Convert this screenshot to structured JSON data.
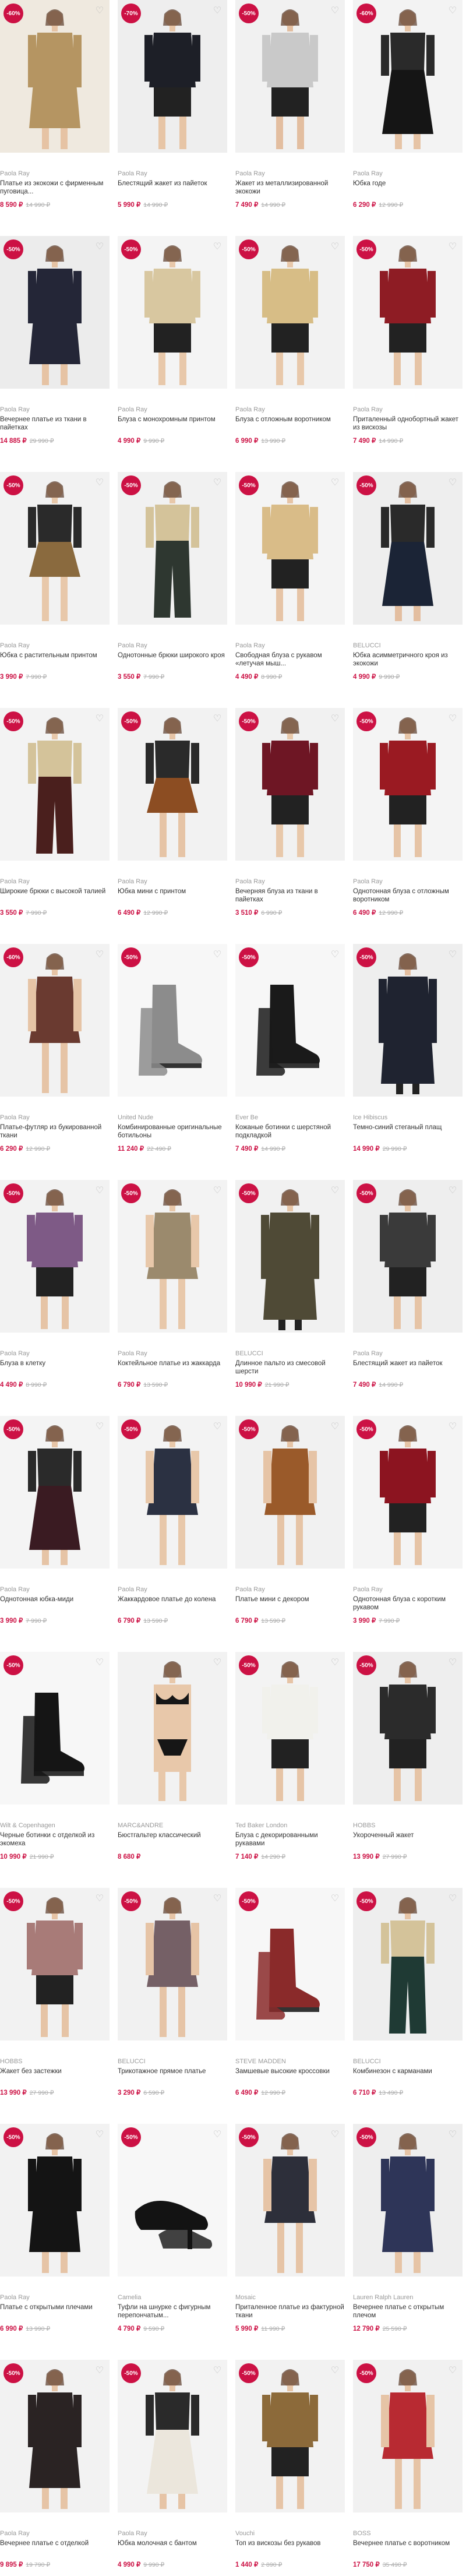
{
  "products": [
    {
      "brand": "Paola Ray",
      "title": "Платье из экокожи с фирменным пуговица...",
      "price": "8 590 ₽",
      "old_price": "14 990 ₽",
      "badge": "-60%",
      "bg": "#efe9df",
      "item": "#b59562",
      "skin": "#e6c3a4",
      "shape": "dress-long"
    },
    {
      "brand": "Paola Ray",
      "title": "Блестящий жакет из пайеток",
      "price": "5 990 ₽",
      "old_price": "14 990 ₽",
      "badge": "-70%",
      "bg": "#eeeeee",
      "item": "#1d1f27",
      "skin": "#e7c5a6",
      "shape": "jacket"
    },
    {
      "brand": "Paola Ray",
      "title": "Жакет из металлизированной экокожи",
      "price": "7 490 ₽",
      "old_price": "14 990 ₽",
      "badge": "-50%",
      "bg": "#f1f1f1",
      "item": "#c9c9c9",
      "skin": "#e3bea0",
      "shape": "jacket"
    },
    {
      "brand": "Paola Ray",
      "title": "Юбка годе",
      "price": "6 290 ₽",
      "old_price": "12 990 ₽",
      "badge": "-60%",
      "bg": "#f3f3f3",
      "item": "#151515",
      "skin": "#e6c4a6",
      "shape": "skirt"
    },
    {
      "brand": "Paola Ray",
      "title": "Вечернее платье из ткани в пайетках",
      "price": "14 885 ₽",
      "old_price": "29 990 ₽",
      "badge": "-50%",
      "bg": "#ececec",
      "item": "#242637",
      "skin": "#e6c3a4",
      "shape": "dress-long"
    },
    {
      "brand": "Paola Ray",
      "title": "Блуза с монохромным принтом",
      "price": "4 990 ₽",
      "old_price": "9 990 ₽",
      "badge": "-50%",
      "bg": "#f4f4f4",
      "item": "#d8c7a0",
      "skin": "#e8c8aa",
      "shape": "blouse"
    },
    {
      "brand": "Paola Ray",
      "title": "Блуза с отложным воротником",
      "price": "6 990 ₽",
      "old_price": "13 990 ₽",
      "badge": "-50%",
      "bg": "#f2f2f2",
      "item": "#d7bd86",
      "skin": "#e8c8aa",
      "shape": "blouse"
    },
    {
      "brand": "Paola Ray",
      "title": "Приталенный однобортный жакет из вискозы",
      "price": "7 490 ₽",
      "old_price": "14 990 ₽",
      "badge": "-50%",
      "bg": "#f3f3f3",
      "item": "#8e1c24",
      "skin": "#e6c4a6",
      "shape": "jacket"
    },
    {
      "brand": "Paola Ray",
      "title": "Юбка с растительным принтом",
      "price": "3 990 ₽",
      "old_price": "7 990 ₽",
      "badge": "-50%",
      "bg": "#f2f2f2",
      "item": "#8a6a3e",
      "skin": "#e8c8aa",
      "shape": "skirt-short"
    },
    {
      "brand": "Paola Ray",
      "title": "Однотонные брюки широкого кроя",
      "price": "3 550 ₽",
      "old_price": "7 990 ₽",
      "badge": "-50%",
      "bg": "#f1f1f1",
      "item": "#2e3730",
      "skin": "#e8c8aa",
      "shape": "trousers"
    },
    {
      "brand": "Paola Ray",
      "title": "Свободная блуза с рукавом «летучая мыш...",
      "price": "4 490 ₽",
      "old_price": "8 990 ₽",
      "badge": "-50%",
      "bg": "#f4f4f4",
      "item": "#d9bc88",
      "skin": "#e6c4a6",
      "shape": "blouse"
    },
    {
      "brand": "BELUCCI",
      "title": "Юбка асимметричного кроя из экокожи",
      "price": "4 990 ₽",
      "old_price": "9 990 ₽",
      "badge": "-50%",
      "bg": "#eeeeee",
      "item": "#1b2436",
      "skin": "#e3bea0",
      "shape": "skirt"
    },
    {
      "brand": "Paola Ray",
      "title": "Широкие брюки с высокой талией",
      "price": "3 550 ₽",
      "old_price": "7 990 ₽",
      "badge": "-50%",
      "bg": "#f3f3f3",
      "item": "#4a1f1d",
      "skin": "#e8c8aa",
      "shape": "trousers"
    },
    {
      "brand": "Paola Ray",
      "title": "Юбка мини с принтом",
      "price": "6 490 ₽",
      "old_price": "12 990 ₽",
      "badge": "-50%",
      "bg": "#f2f2f2",
      "item": "#8c4d22",
      "skin": "#e6c4a6",
      "shape": "skirt-short"
    },
    {
      "brand": "Paola Ray",
      "title": "Вечерняя блуза из ткани в пайетках",
      "price": "3 510 ₽",
      "old_price": "6 990 ₽",
      "badge": "-50%",
      "bg": "#f1f1f1",
      "item": "#6e1624",
      "skin": "#e8c8aa",
      "shape": "blouse"
    },
    {
      "brand": "Paola Ray",
      "title": "Однотонная блуза с отложным воротником",
      "price": "6 490 ₽",
      "old_price": "12 990 ₽",
      "badge": "-50%",
      "bg": "#f4f4f4",
      "item": "#9a1a22",
      "skin": "#e6c4a6",
      "shape": "blouse"
    },
    {
      "brand": "Paola Ray",
      "title": "Платье-футляр из букированной ткани",
      "price": "6 290 ₽",
      "old_price": "12 990 ₽",
      "badge": "-60%",
      "bg": "#f2f2f2",
      "item": "#6a3a30",
      "skin": "#e6c4a6",
      "shape": "dress"
    },
    {
      "brand": "United Nude",
      "title": "Комбинированные оригинальные ботильоны",
      "price": "11 240 ₽",
      "old_price": "22 490 ₽",
      "badge": "-50%",
      "bg": "#f7f7f7",
      "item": "#8c8c8c",
      "skin": "#f7f7f7",
      "shape": "boot"
    },
    {
      "brand": "Ever Be",
      "title": "Кожаные ботинки с шерстяной подкладкой",
      "price": "7 490 ₽",
      "old_price": "14 990 ₽",
      "badge": "-50%",
      "bg": "#f7f7f7",
      "item": "#1a1a1a",
      "skin": "#f7f7f7",
      "shape": "boot"
    },
    {
      "brand": "Ice Hibiscus",
      "title": "Темно-синий стеганый плащ",
      "price": "14 990 ₽",
      "old_price": "29 990 ₽",
      "badge": "-50%",
      "bg": "#eeeeee",
      "item": "#1f2330",
      "skin": "#e3bea0",
      "shape": "coat"
    },
    {
      "brand": "Paola Ray",
      "title": "Блуза в клетку",
      "price": "4 490 ₽",
      "old_price": "8 990 ₽",
      "badge": "-50%",
      "bg": "#f2f2f2",
      "item": "#7e5a86",
      "skin": "#e6c4a6",
      "shape": "blouse"
    },
    {
      "brand": "Paola Ray",
      "title": "Коктейльное платье из жаккарда",
      "price": "6 790 ₽",
      "old_price": "13 590 ₽",
      "badge": "-50%",
      "bg": "#f3f3f3",
      "item": "#9b8a6d",
      "skin": "#e8c8aa",
      "shape": "dress"
    },
    {
      "brand": "BELUCCI",
      "title": "Длинное пальто из смесовой шерсти",
      "price": "10 990 ₽",
      "old_price": "21 990 ₽",
      "badge": "-50%",
      "bg": "#f1f1f1",
      "item": "#4f4a36",
      "skin": "#e6c4a6",
      "shape": "coat"
    },
    {
      "brand": "Paola Ray",
      "title": "Блестящий жакет из пайеток",
      "price": "7 490 ₽",
      "old_price": "14 990 ₽",
      "badge": "-50%",
      "bg": "#eeeeee",
      "item": "#3a3a3a",
      "skin": "#e6c4a6",
      "shape": "jacket"
    },
    {
      "brand": "Paola Ray",
      "title": "Однотонная юбка-миди",
      "price": "3 990 ₽",
      "old_price": "7 990 ₽",
      "badge": "-50%",
      "bg": "#f4f4f4",
      "item": "#3a1b22",
      "skin": "#e6c4a6",
      "shape": "skirt"
    },
    {
      "brand": "Paola Ray",
      "title": "Жаккардовое платье до колена",
      "price": "6 790 ₽",
      "old_price": "13 590 ₽",
      "badge": "-50%",
      "bg": "#f3f3f3",
      "item": "#2b3142",
      "skin": "#e8c8aa",
      "shape": "dress"
    },
    {
      "brand": "Paola Ray",
      "title": "Платье мини с декором",
      "price": "6 790 ₽",
      "old_price": "13 590 ₽",
      "badge": "-50%",
      "bg": "#f1f1f1",
      "item": "#9a5a2a",
      "skin": "#e6c4a6",
      "shape": "dress"
    },
    {
      "brand": "Paola Ray",
      "title": "Однотонная блуза с коротким рукавом",
      "price": "3 990 ₽",
      "old_price": "7 990 ₽",
      "badge": "-50%",
      "bg": "#f4f4f4",
      "item": "#8c1420",
      "skin": "#e6c4a6",
      "shape": "blouse"
    },
    {
      "brand": "Wilt & Copenhagen",
      "title": "Черные ботинки с отделкой из экомеха",
      "price": "10 990 ₽",
      "old_price": "21 990 ₽",
      "badge": "-50%",
      "bg": "#f7f7f7",
      "item": "#151515",
      "skin": "#f7f7f7",
      "shape": "boot"
    },
    {
      "brand": "MARC&ANDRE",
      "title": "Бюстгальтер классический",
      "price": "8 680 ₽",
      "old_price": "",
      "badge": "",
      "bg": "#f2f2f2",
      "item": "#161616",
      "skin": "#e8c8aa",
      "shape": "lingerie"
    },
    {
      "brand": "Ted Baker London",
      "title": "Блуза с декорированными рукавами",
      "price": "7 140 ₽",
      "old_price": "14 290 ₽",
      "badge": "-50%",
      "bg": "#f3f3f3",
      "item": "#f1f1ec",
      "skin": "#e6c4a6",
      "shape": "blouse"
    },
    {
      "brand": "HOBBS",
      "title": "Укороченный жакет",
      "price": "13 990 ₽",
      "old_price": "27 990 ₽",
      "badge": "-50%",
      "bg": "#eeeeee",
      "item": "#2b2b2b",
      "skin": "#e6c4a6",
      "shape": "jacket"
    },
    {
      "brand": "HOBBS",
      "title": "Жакет без застежки",
      "price": "13 990 ₽",
      "old_price": "27 990 ₽",
      "badge": "-50%",
      "bg": "#f2f2f2",
      "item": "#a87b78",
      "skin": "#e6c4a6",
      "shape": "jacket"
    },
    {
      "brand": "BELUCCI",
      "title": "Трикотажное прямое платье",
      "price": "3 290 ₽",
      "old_price": "6 590 ₽",
      "badge": "-50%",
      "bg": "#f1f1f1",
      "item": "#756066",
      "skin": "#e6c4a6",
      "shape": "dress"
    },
    {
      "brand": "STEVE MADDEN",
      "title": "Замшевые высокие кроссовки",
      "price": "6 490 ₽",
      "old_price": "12 990 ₽",
      "badge": "-50%",
      "bg": "#f7f7f7",
      "item": "#8a2a2a",
      "skin": "#f7f7f7",
      "shape": "boot"
    },
    {
      "brand": "BELUCCI",
      "title": "Комбинезон с карманами",
      "price": "6 710 ₽",
      "old_price": "13 490 ₽",
      "badge": "-50%",
      "bg": "#eeeeee",
      "item": "#1f3a34",
      "skin": "#e6c4a6",
      "shape": "trousers"
    },
    {
      "brand": "Paola Ray",
      "title": "Платье с открытыми плечами",
      "price": "6 990 ₽",
      "old_price": "13 990 ₽",
      "badge": "-50%",
      "bg": "#f2f2f2",
      "item": "#141414",
      "skin": "#e6c4a6",
      "shape": "dress-long"
    },
    {
      "brand": "Camelia",
      "title": "Туфли на шнурке с фигурным перепончатым...",
      "price": "4 790 ₽",
      "old_price": "9 590 ₽",
      "badge": "-50%",
      "bg": "#f7f7f7",
      "item": "#131313",
      "skin": "#f7f7f7",
      "shape": "shoe"
    },
    {
      "brand": "Mosaic",
      "title": "Приталенное платье из фактурной ткани",
      "price": "5 990 ₽",
      "old_price": "11 990 ₽",
      "badge": "-50%",
      "bg": "#f1f1f1",
      "item": "#2d2f3a",
      "skin": "#e6c4a6",
      "shape": "dress"
    },
    {
      "brand": "Lauren Ralph Lauren",
      "title": "Вечернее платье с открытым плечом",
      "price": "12 790 ₽",
      "old_price": "25 590 ₽",
      "badge": "-50%",
      "bg": "#eeeeee",
      "item": "#2e3558",
      "skin": "#e6c4a6",
      "shape": "dress-long"
    },
    {
      "brand": "Paola Ray",
      "title": "Вечернее платье с отделкой",
      "price": "9 895 ₽",
      "old_price": "19 790 ₽",
      "badge": "-50%",
      "bg": "#f2f2f2",
      "item": "#2a2323",
      "skin": "#e6c4a6",
      "shape": "dress-long"
    },
    {
      "brand": "Paola Ray",
      "title": "Юбка молочная с бантом",
      "price": "4 990 ₽",
      "old_price": "9 990 ₽",
      "badge": "-50%",
      "bg": "#f3f3f3",
      "item": "#ebe6dc",
      "skin": "#e6c4a6",
      "shape": "skirt"
    },
    {
      "brand": "Vouchi",
      "title": "Топ из вискозы без рукавов",
      "price": "1 440 ₽",
      "old_price": "2 890 ₽",
      "badge": "-50%",
      "bg": "#f2f2f2",
      "item": "#8c6a3a",
      "skin": "#e6c4a6",
      "shape": "blouse"
    },
    {
      "brand": "BOSS",
      "title": "Вечернее платье с воротником",
      "price": "17 750 ₽",
      "old_price": "35 490 ₽",
      "badge": "-50%",
      "bg": "#f1f1f1",
      "item": "#b82a32",
      "skin": "#e6c4a6",
      "shape": "dress"
    }
  ]
}
